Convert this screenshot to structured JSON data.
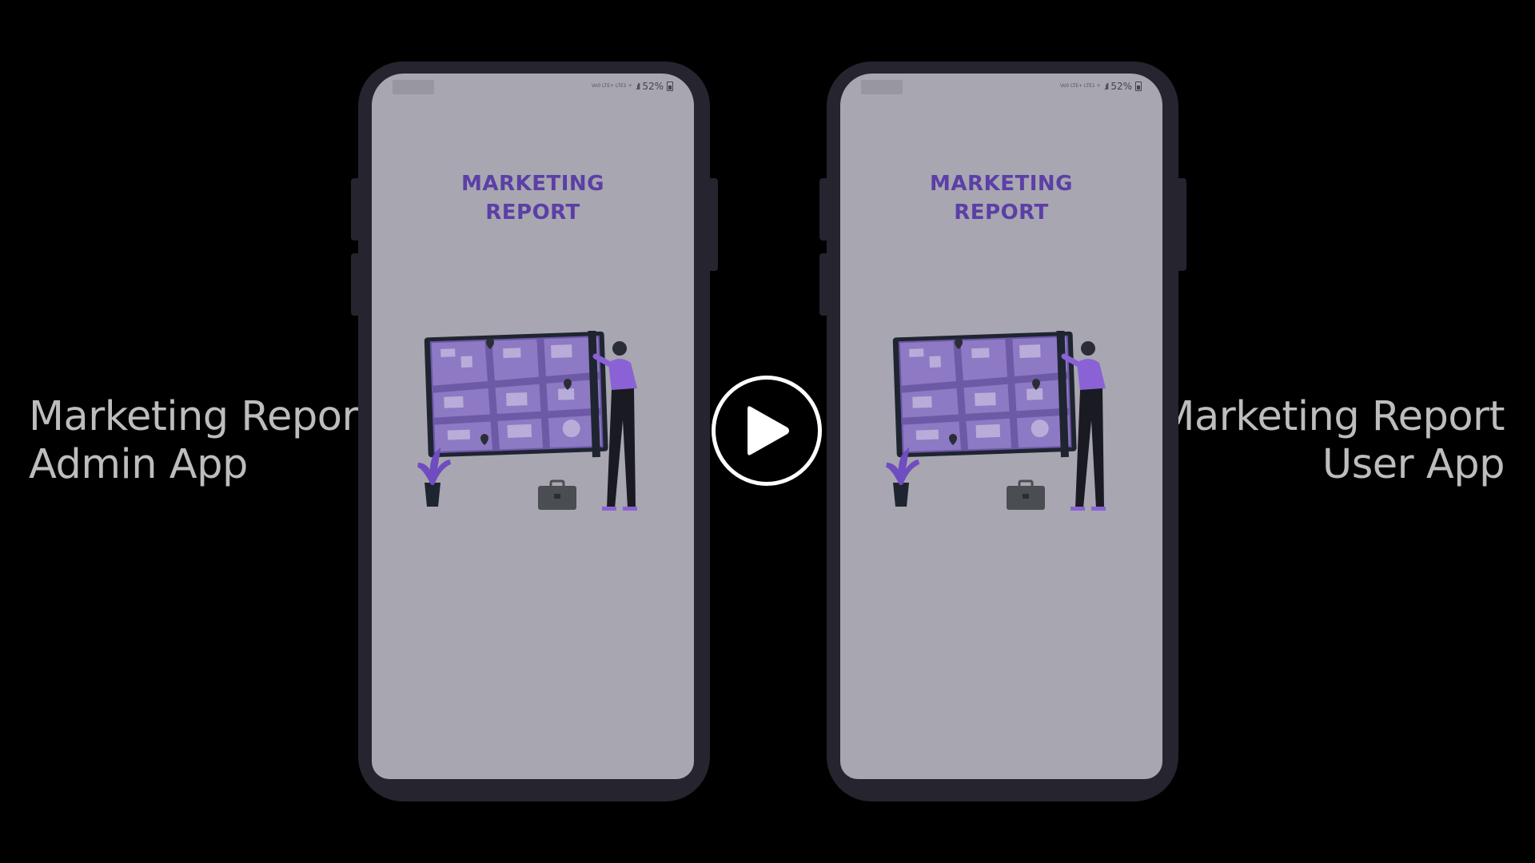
{
  "left_caption": {
    "line1": "Marketing Report",
    "line2": "Admin App"
  },
  "right_caption": {
    "line1": "Marketing Report",
    "line2": "User App"
  },
  "phones": [
    {
      "status": {
        "signal_text": "Vo0 LTE+ LTE1 +",
        "battery": "52%"
      },
      "app_title": {
        "line1": "MARKETING",
        "line2": "REPORT"
      }
    },
    {
      "status": {
        "signal_text": "Vo0 LTE+ LTE1 +",
        "battery": "52%"
      },
      "app_title": {
        "line1": "MARKETING",
        "line2": "REPORT"
      }
    }
  ],
  "colors": {
    "background": "#000000",
    "phone_frame": "#26242e",
    "screen": "#a8a6b0",
    "brand_purple": "#5b3fa6",
    "caption": "#bdbdbd"
  },
  "icons": {
    "play": "play-icon"
  }
}
